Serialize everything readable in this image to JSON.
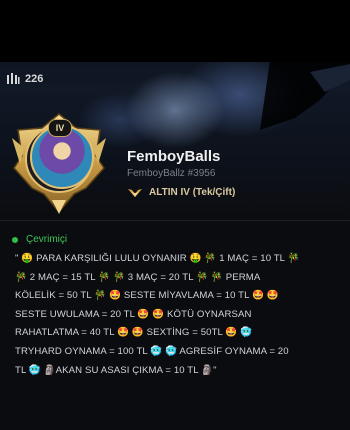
{
  "header": {
    "honor_icon": "honor-level-icon",
    "honor_count": "226"
  },
  "profile": {
    "rank_emblem_icon": "gold-rank-emblem-icon",
    "level_badge": "IV",
    "summoner_name": "FemboyBalls",
    "riot_tag": "FemboyBallz #3956",
    "rank_icon": "gold-wings-icon",
    "rank_text": "ALTIN IV (Tek/Çift)"
  },
  "status": {
    "text": "Çevrimiçi",
    "color": "#2fbf4a"
  },
  "bio": {
    "lines": [
      "\" 🤑 PARA KARŞILIĞI LULU OYNANIR 🤑 🎋 1 MAÇ = 10 TL 🎋",
      "🎋 2 MAÇ = 15 TL 🎋 🎋 3 MAÇ = 20 TL 🎋 🎋 PERMA",
      "KÖLELİK = 50 TL 🎋 🤩 SESTE MİYAVLAMA = 10 TL 🤩 🤩",
      "SESTE UWULAMA = 20 TL 🤩 🤩 KÖTÜ OYNARSAN",
      "RAHATLATMA = 40 TL 🤩 🤩 SEXTİNG = 50TL 🤩 🥶",
      "TRYHARD OYNAMA = 100 TL 🥶 🥶 AGRESİF OYNAMA = 20",
      "TL 🥶 🗿AKAN SU ASASI ÇIKMA = 10 TL 🗿\""
    ]
  }
}
